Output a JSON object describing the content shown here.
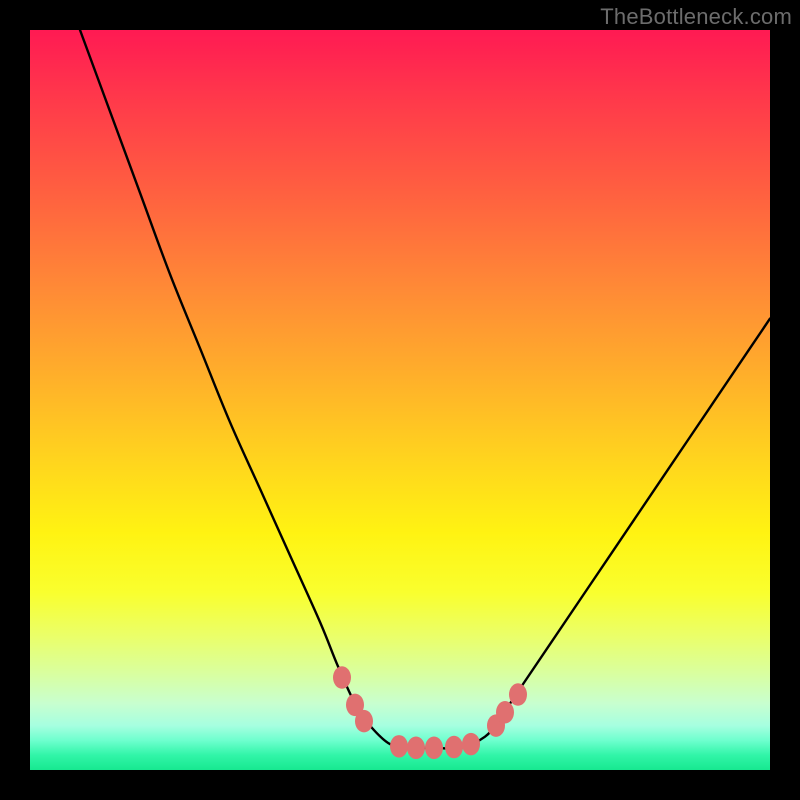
{
  "watermark": {
    "text": "TheBottleneck.com"
  },
  "chart_data": {
    "type": "line",
    "title": "",
    "xlabel": "",
    "ylabel": "",
    "x_range": [
      0,
      740
    ],
    "y_range_pct": [
      0,
      100
    ],
    "series": [
      {
        "name": "bottleneck-curve",
        "x": [
          50,
          80,
          110,
          140,
          170,
          200,
          230,
          260,
          290,
          308,
          325,
          340,
          360,
          380,
          405,
          430,
          455,
          470,
          490,
          520,
          560,
          600,
          640,
          680,
          720,
          740
        ],
        "y_pct": [
          100,
          89,
          78,
          67,
          57,
          47,
          38,
          29,
          20,
          14,
          9,
          6,
          3.5,
          3,
          3,
          3,
          4.5,
          7,
          11,
          17,
          25,
          33,
          41,
          49,
          57,
          61
        ]
      }
    ],
    "markers": {
      "name": "threshold-dots",
      "color": "#e07070",
      "radius": 9,
      "points": [
        {
          "x": 312,
          "y_pct": 12.5
        },
        {
          "x": 325,
          "y_pct": 8.8
        },
        {
          "x": 334,
          "y_pct": 6.6
        },
        {
          "x": 369,
          "y_pct": 3.2
        },
        {
          "x": 386,
          "y_pct": 3.0
        },
        {
          "x": 404,
          "y_pct": 3.0
        },
        {
          "x": 424,
          "y_pct": 3.1
        },
        {
          "x": 441,
          "y_pct": 3.5
        },
        {
          "x": 466,
          "y_pct": 6.0
        },
        {
          "x": 475,
          "y_pct": 7.8
        },
        {
          "x": 488,
          "y_pct": 10.2
        }
      ]
    },
    "background_gradient": {
      "direction": "top-to-bottom",
      "stops": [
        {
          "pct": 0,
          "color": "#ff1a53"
        },
        {
          "pct": 35,
          "color": "#ff8a36"
        },
        {
          "pct": 68,
          "color": "#fff312"
        },
        {
          "pct": 100,
          "color": "#17e890"
        }
      ]
    }
  }
}
